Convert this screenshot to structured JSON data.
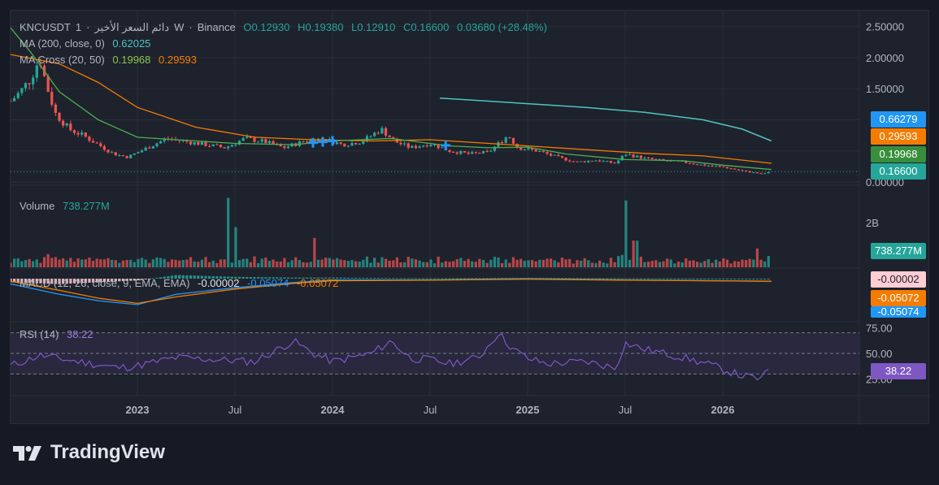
{
  "header": {
    "symbol": "KNCUSDT",
    "interval": "1",
    "sep1": "·",
    "title_arabic": "دائم السعر الأخير",
    "title_suffix": "W",
    "sep2": "·",
    "exchange": "Binance",
    "ohlc": {
      "O": "O0.12930",
      "H": "H0.19380",
      "L": "L0.12910",
      "C": "C0.16600"
    },
    "change": "0.03680 (+28.48%)"
  },
  "legends": {
    "ma200_label": "MA (200, close, 0)",
    "ma200_value": "0.62025",
    "macross_label": "MA Cross (20, 50)",
    "macross_fast": "0.19968",
    "macross_slow": "0.29593",
    "volume_label": "Volume",
    "volume_value": "738.277M",
    "macd_label": "MACD (12, 26, close, 9, EMA, EMA)",
    "macd_hist": "-0.00002",
    "macd_line": "-0.05074",
    "macd_signal": "-0.05072",
    "rsi_label": "RSI (14)",
    "rsi_value": "38.22"
  },
  "price_tags": {
    "ma200": "0.66279",
    "slow": "0.29593",
    "fast": "0.19968",
    "close": "0.16600",
    "volume": "738.277M",
    "macd_hist": "-0.00002",
    "macd_signal": "-0.05072",
    "macd_line": "-0.05074",
    "rsi": "38.22"
  },
  "colors": {
    "up": "#26a69a",
    "down": "#ef5350",
    "ma200": "#4fc3c0",
    "fast": "#4caf50",
    "slow": "#f57c00",
    "macd": "#2196f3",
    "signal": "#f57c00",
    "rsi": "#7e57c2"
  },
  "chart_data": {
    "type": "candlestick",
    "x_ticks": [
      "2023",
      "Jul",
      "2024",
      "Jul",
      "2025",
      "Jul",
      "2026"
    ],
    "price_axis": [
      "2.50000",
      "2.00000",
      "1.50000",
      "0.00000"
    ],
    "price_ylim": [
      0,
      2.6
    ],
    "volume_axis": [
      "2B"
    ],
    "rsi_axis": [
      "75.00",
      "50.00",
      "25.00"
    ],
    "rsi_levels": [
      70,
      50,
      30
    ],
    "price_path": [
      [
        2022.35,
        1.3
      ],
      [
        2022.4,
        1.45
      ],
      [
        2022.45,
        1.65
      ],
      [
        2022.5,
        2.0
      ],
      [
        2022.53,
        1.6
      ],
      [
        2022.58,
        1.1
      ],
      [
        2022.65,
        0.85
      ],
      [
        2022.72,
        0.75
      ],
      [
        2022.8,
        0.6
      ],
      [
        2022.88,
        0.45
      ],
      [
        2022.95,
        0.4
      ],
      [
        2023.05,
        0.55
      ],
      [
        2023.15,
        0.7
      ],
      [
        2023.25,
        0.65
      ],
      [
        2023.35,
        0.6
      ],
      [
        2023.45,
        0.55
      ],
      [
        2023.55,
        0.7
      ],
      [
        2023.65,
        0.65
      ],
      [
        2023.75,
        0.55
      ],
      [
        2023.85,
        0.65
      ],
      [
        2023.95,
        0.7
      ],
      [
        2024.05,
        0.6
      ],
      [
        2024.15,
        0.65
      ],
      [
        2024.25,
        0.85
      ],
      [
        2024.32,
        0.65
      ],
      [
        2024.4,
        0.55
      ],
      [
        2024.5,
        0.62
      ],
      [
        2024.6,
        0.5
      ],
      [
        2024.7,
        0.45
      ],
      [
        2024.8,
        0.48
      ],
      [
        2024.9,
        0.75
      ],
      [
        2024.95,
        0.55
      ],
      [
        2025.05,
        0.5
      ],
      [
        2025.15,
        0.4
      ],
      [
        2025.25,
        0.32
      ],
      [
        2025.35,
        0.35
      ],
      [
        2025.45,
        0.3
      ],
      [
        2025.5,
        0.45
      ],
      [
        2025.6,
        0.38
      ],
      [
        2025.7,
        0.34
      ],
      [
        2025.8,
        0.32
      ],
      [
        2025.9,
        0.27
      ],
      [
        2026.0,
        0.24
      ],
      [
        2026.1,
        0.18
      ],
      [
        2026.2,
        0.13
      ],
      [
        2026.25,
        0.166
      ]
    ],
    "ma200_path": [
      [
        2024.55,
        1.35
      ],
      [
        2024.8,
        1.3
      ],
      [
        2025.0,
        1.26
      ],
      [
        2025.3,
        1.2
      ],
      [
        2025.6,
        1.12
      ],
      [
        2025.9,
        1.0
      ],
      [
        2026.1,
        0.85
      ],
      [
        2026.25,
        0.66
      ]
    ],
    "ma_fast_path": [
      [
        2022.35,
        2.48
      ],
      [
        2022.45,
        2.1
      ],
      [
        2022.6,
        1.45
      ],
      [
        2022.8,
        1.0
      ],
      [
        2023.0,
        0.72
      ],
      [
        2023.2,
        0.68
      ],
      [
        2023.5,
        0.62
      ],
      [
        2023.8,
        0.6
      ],
      [
        2024.0,
        0.66
      ],
      [
        2024.3,
        0.7
      ],
      [
        2024.6,
        0.58
      ],
      [
        2024.8,
        0.55
      ],
      [
        2025.0,
        0.56
      ],
      [
        2025.2,
        0.45
      ],
      [
        2025.5,
        0.36
      ],
      [
        2025.8,
        0.34
      ],
      [
        2026.0,
        0.27
      ],
      [
        2026.25,
        0.2
      ]
    ],
    "ma_slow_path": [
      [
        2022.35,
        2.05
      ],
      [
        2022.6,
        1.9
      ],
      [
        2022.8,
        1.6
      ],
      [
        2023.0,
        1.2
      ],
      [
        2023.3,
        0.88
      ],
      [
        2023.6,
        0.72
      ],
      [
        2023.9,
        0.68
      ],
      [
        2024.2,
        0.66
      ],
      [
        2024.5,
        0.68
      ],
      [
        2024.8,
        0.62
      ],
      [
        2025.0,
        0.58
      ],
      [
        2025.3,
        0.52
      ],
      [
        2025.6,
        0.46
      ],
      [
        2025.9,
        0.42
      ],
      [
        2026.25,
        0.3
      ]
    ],
    "volume_spikes": [
      [
        2023.47,
        2.6
      ],
      [
        2023.5,
        1.5
      ],
      [
        2023.9,
        1.1
      ],
      [
        2025.5,
        2.5
      ],
      [
        2025.55,
        1.0
      ],
      [
        2026.18,
        0.7
      ],
      [
        2026.25,
        0.74
      ]
    ],
    "rsi_path": [
      [
        2022.35,
        38
      ],
      [
        2022.5,
        48
      ],
      [
        2022.7,
        42
      ],
      [
        2022.9,
        36
      ],
      [
        2023.0,
        38
      ],
      [
        2023.2,
        46
      ],
      [
        2023.4,
        44
      ],
      [
        2023.6,
        42
      ],
      [
        2023.8,
        62
      ],
      [
        2023.9,
        50
      ],
      [
        2024.0,
        42
      ],
      [
        2024.2,
        50
      ],
      [
        2024.3,
        62
      ],
      [
        2024.4,
        45
      ],
      [
        2024.5,
        44
      ],
      [
        2024.6,
        40
      ],
      [
        2024.75,
        46
      ],
      [
        2024.85,
        70
      ],
      [
        2024.92,
        55
      ],
      [
        2025.0,
        45
      ],
      [
        2025.1,
        40
      ],
      [
        2025.3,
        42
      ],
      [
        2025.45,
        36
      ],
      [
        2025.5,
        60
      ],
      [
        2025.6,
        54
      ],
      [
        2025.8,
        46
      ],
      [
        2025.95,
        38
      ],
      [
        2026.1,
        28
      ],
      [
        2026.2,
        25
      ],
      [
        2026.25,
        38
      ]
    ]
  },
  "footer": {
    "brand": "TradingView"
  }
}
